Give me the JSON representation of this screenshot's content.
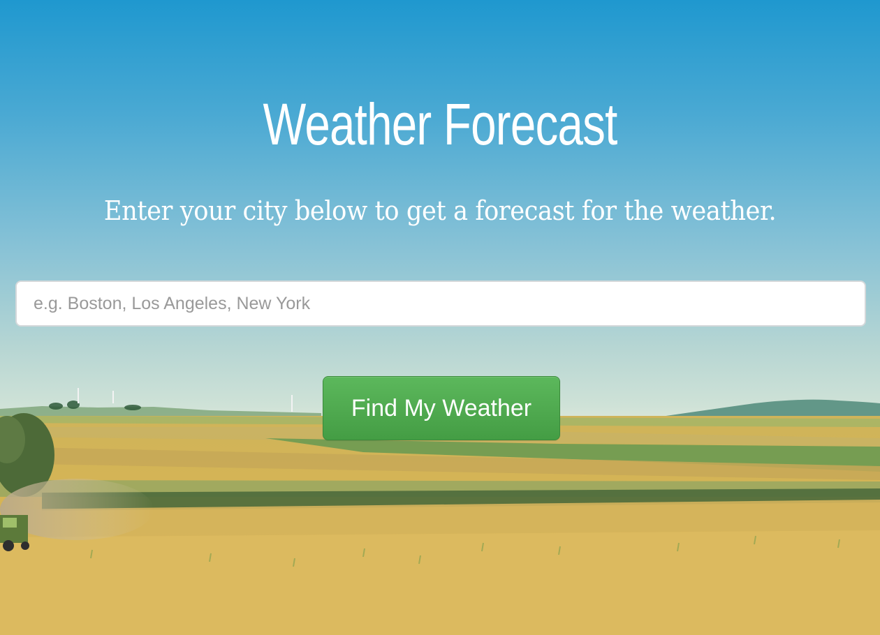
{
  "header": {
    "title": "Weather Forecast",
    "subtitle": "Enter your city below to get a forecast for the weather."
  },
  "search": {
    "placeholder": "e.g. Boston, Los Angeles, New York",
    "value": ""
  },
  "actions": {
    "find_label": "Find My Weather"
  },
  "colors": {
    "sky_top": "#1f98cf",
    "sky_horizon": "#cfe2d7",
    "button_green": "#5cb85c",
    "field_gold": "#d9b24a"
  },
  "background": {
    "scene": "farm-field-landscape"
  }
}
